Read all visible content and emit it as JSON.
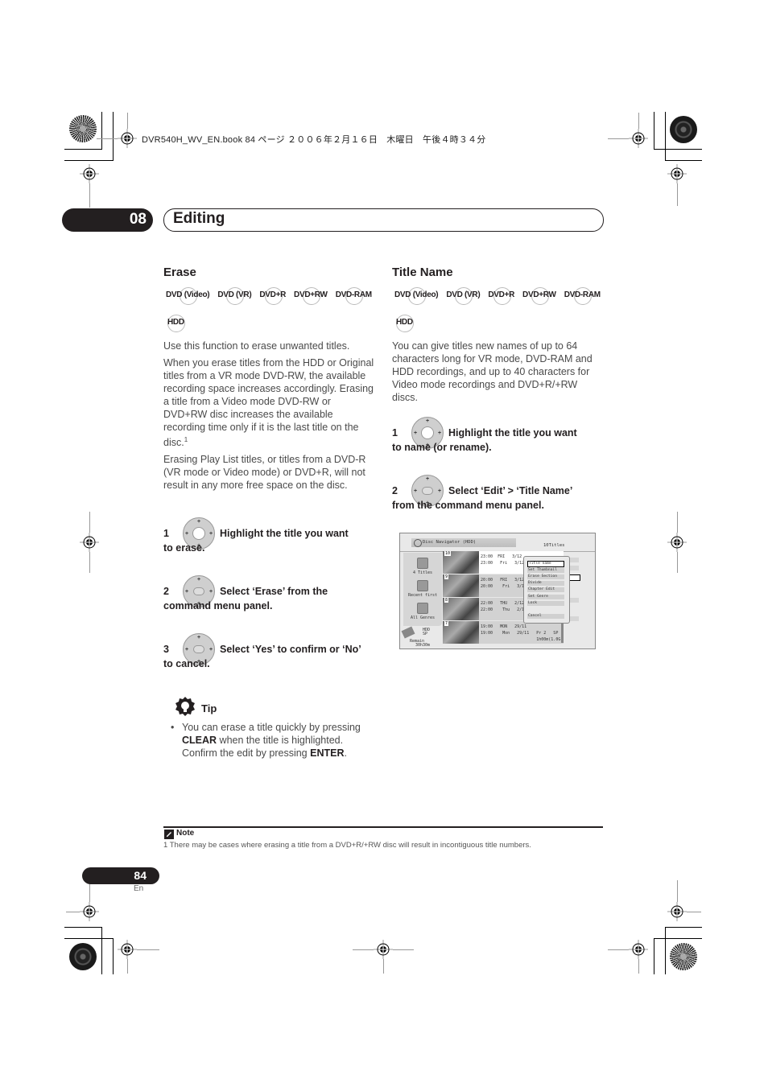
{
  "print_header": {
    "text": "DVR540H_WV_EN.book  84 ページ  ２００６年２月１６日　木曜日　午後４時３４分"
  },
  "chapter": {
    "number": "08",
    "title": "Editing"
  },
  "erase": {
    "heading": "Erase",
    "formats": [
      "DVD (Video)",
      "DVD (VR)",
      "DVD+R",
      "DVD+RW",
      "DVD-RAM"
    ],
    "formats_row2": [
      "HDD"
    ],
    "paragraphs": [
      "Use this function to erase unwanted titles.",
      "When you erase titles from the HDD or Original titles from a VR mode DVD-RW, the available recording space increases accordingly. Erasing a title from a Video mode DVD-RW or DVD+RW disc increases the available recording time only if it is the last title on the disc.",
      "Erasing Play List titles, or titles from a DVD-R (VR mode or Video mode) or DVD+R, will not result in any more free space on the disc."
    ],
    "footnote_ref": "1",
    "steps": [
      {
        "num": "1",
        "line1": "Highlight the title you want",
        "line2": "to erase.",
        "icon": "dpad-arrows-icon"
      },
      {
        "num": "2",
        "line1": "Select ‘Erase’ from the",
        "line2": "command menu panel.",
        "icon": "dpad-enter-icon"
      },
      {
        "num": "3",
        "line1": "Select ‘Yes’ to confirm or ‘No’",
        "line2": "to cancel.",
        "icon": "dpad-enter-icon"
      }
    ],
    "tip": {
      "label": "Tip",
      "bullet": "•",
      "pre": "You can erase a title quickly by pressing ",
      "key1": "CLEAR",
      "mid": " when the title is highlighted. Confirm the edit by pressing ",
      "key2": "ENTER",
      "post": "."
    }
  },
  "title_name": {
    "heading": "Title Name",
    "formats": [
      "DVD (Video)",
      "DVD (VR)",
      "DVD+R",
      "DVD+RW",
      "DVD-RAM"
    ],
    "formats_row2": [
      "HDD"
    ],
    "paragraph": "You can give titles new names of up to 64 characters long for VR mode, DVD-RAM and HDD recordings, and up to 40 characters for Video mode recordings and DVD+R/+RW discs.",
    "steps": [
      {
        "num": "1",
        "line1": "Highlight the title you want",
        "line2": "to name (or rename).",
        "icon": "dpad-arrows-icon"
      },
      {
        "num": "2",
        "line1": "Select ‘Edit’ > ‘Title Name’",
        "line2": "from the command menu panel.",
        "icon": "dpad-enter-icon"
      }
    ],
    "screen": {
      "title": "Disc Navigator (HDD)",
      "count": "10Titles",
      "side_items": [
        "4 Titles",
        "Recent first",
        "All Genres"
      ],
      "hdd_label": "HDD",
      "mode": "SP",
      "remain_label": "Remain",
      "remain_value": "30h30m",
      "rows": [
        {
          "num": "10",
          "line1": "23:00  FRI   3/12",
          "line2": "23:00   Fri   3/12",
          "selected": true
        },
        {
          "num": "9",
          "line1": "20:00   FRI   3/12",
          "line2": "20:00    Fri   3/12",
          "selected": false
        },
        {
          "num": "8",
          "line1": "22:00   THU   2/12",
          "line2": "22:00    Thu   2/12",
          "selected": false
        },
        {
          "num": "7",
          "line1": "19:00   MON   29/11",
          "line2": "19:00    Mon   29/11   Pr 2   SP",
          "line3": "                       1h00m(1.0G)",
          "selected": false
        }
      ],
      "menu_items": [
        "Title name",
        "Set Thumbnail",
        "Erase Section",
        "Divide",
        "Chapter Edit",
        "Set Genre",
        "Lock",
        "Cancel"
      ],
      "menu_selected": "Title name"
    }
  },
  "note": {
    "label": "Note",
    "text": "1 There may be cases where erasing a title from a DVD+R/+RW disc will result in incontiguous title numbers."
  },
  "page": {
    "number": "84",
    "lang": "En"
  }
}
